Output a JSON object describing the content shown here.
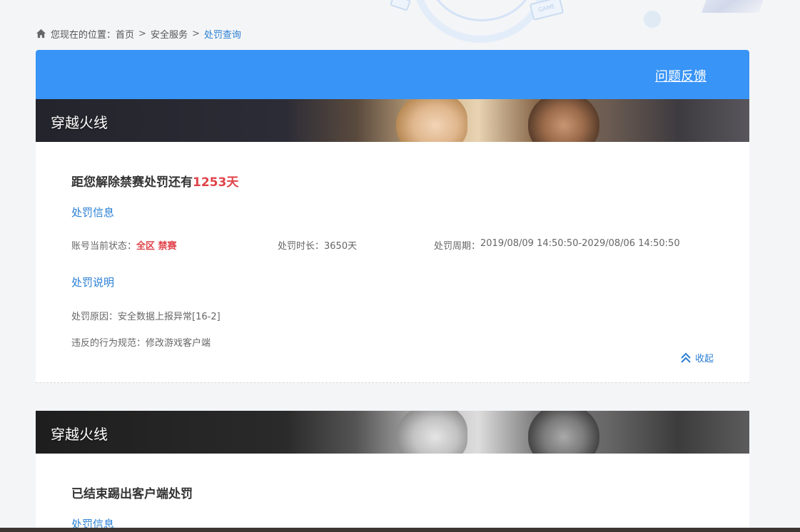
{
  "breadcrumb": {
    "prefix": "您现在的位置：",
    "items": [
      "首页",
      "安全服务"
    ],
    "separator": ">",
    "current": "处罚查询"
  },
  "header": {
    "feedback_label": "问题反馈",
    "color": "#3894f6"
  },
  "panels": [
    {
      "game_title": "穿越火线",
      "headline_prefix": "距您解除禁赛处罚还有",
      "headline_value": "1253天",
      "info_title": "处罚信息",
      "status_label": "账号当前状态：",
      "status_value": "全区 禁赛",
      "duration_label": "处罚时长：",
      "duration_value": "3650天",
      "period_label": "处罚周期：",
      "period_value": "2019/08/09 14:50:50-2029/08/06 14:50:50",
      "desc_title": "处罚说明",
      "reason_label": "处罚原因：",
      "reason_value": "安全数据上报异常[16-2]",
      "rule_label": "违反的行为规范：",
      "rule_value": "修改游戏客户端",
      "collapse_label": "收起"
    },
    {
      "game_title": "穿越火线",
      "headline": "已结束踢出客户端处罚",
      "info_title": "处罚信息"
    }
  ],
  "decor": {
    "game_badge": "GAME"
  },
  "colors": {
    "accent": "#2a7fd4",
    "alert": "#e0434a"
  }
}
